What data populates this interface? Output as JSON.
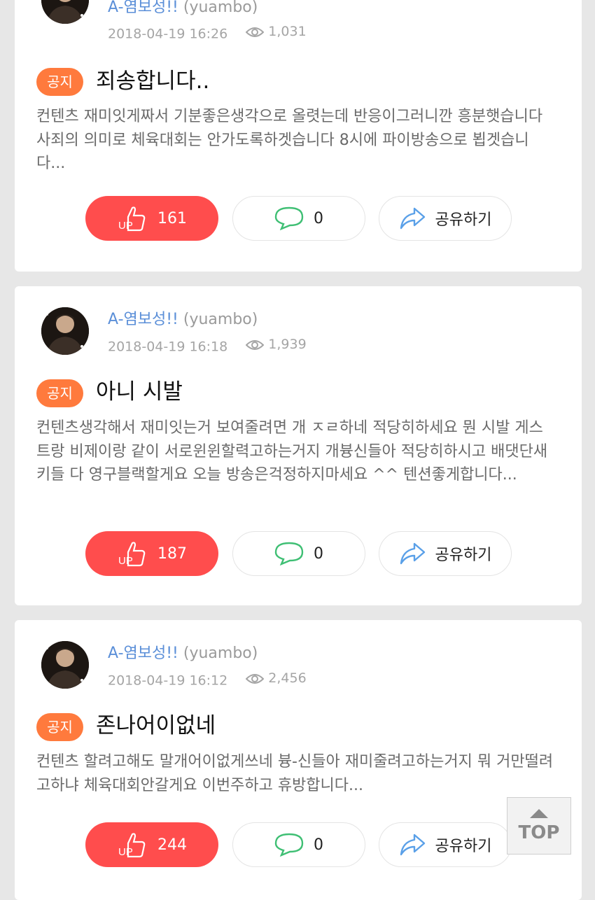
{
  "posts": [
    {
      "author": "A-염보성!!",
      "handle": "(yuambo)",
      "date": "2018-04-19 16:26",
      "views": "1,031",
      "badge": "공지",
      "title": "죄송합니다..",
      "body": "컨텐츠 재미잇게짜서 기분좋은생각으로 올렷는데 반응이그러니깐 흥분햇습니다 사죄의 의미로 체육대회는 안가도록하겟습니다 8시에 파이방송으로 뵙겟습니다...",
      "up_count": "161",
      "comment_count": "0",
      "share_label": "공유하기"
    },
    {
      "author": "A-염보성!!",
      "handle": "(yuambo)",
      "date": "2018-04-19 16:18",
      "views": "1,939",
      "badge": "공지",
      "title": "아니 시발",
      "body": "컨텐츠생각해서 재미잇는거 보여줄려면 개 ㅈㄹ하네 적당히하세요 뭔 시발 게스트랑 비제이랑 같이 서로윈윈할력고하는거지 개븅신들아 적당히하시고 배댓단새키들 다 영구블랙할게요 오늘 방송은걱정하지마세요 ^^ 텐션좋게합니다...",
      "up_count": "187",
      "comment_count": "0",
      "share_label": "공유하기"
    },
    {
      "author": "A-염보성!!",
      "handle": "(yuambo)",
      "date": "2018-04-19 16:12",
      "views": "2,456",
      "badge": "공지",
      "title": "존나어이없네",
      "body": "컨텐츠 할려고해도 말개어이없게쓰네 븅-신들아 재미줄려고하는거지 뭐 거만떨려고하냐 체육대회안갈게요 이번주하고 휴방합니다...",
      "up_count": "244",
      "comment_count": "0",
      "share_label": "공유하기"
    }
  ],
  "top_button": {
    "label": "TOP"
  },
  "colors": {
    "author": "#5b8fd8",
    "badge": "#ff7a3d",
    "up_button": "#ff4d4d",
    "comment_icon": "#3fbf74",
    "share_icon": "#5aa0e8",
    "background": "#e7e7e7"
  },
  "icons": {
    "up": "thumbs-up-icon",
    "comment": "speech-bubble-icon",
    "share": "share-arrow-icon",
    "views": "eye-icon",
    "top": "arrow-up-icon"
  }
}
